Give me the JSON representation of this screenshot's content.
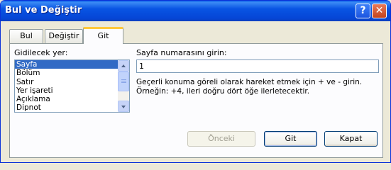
{
  "window": {
    "title": "Bul ve Değiştir"
  },
  "titlebar_buttons": {
    "help": "?",
    "close": "✕"
  },
  "tabs": [
    {
      "label": "Bul"
    },
    {
      "label": "Değiştir"
    },
    {
      "label": "Git",
      "selected": true
    }
  ],
  "goto_list": {
    "label": "Gidilecek yer:",
    "items": [
      "Sayfa",
      "Bölüm",
      "Satır",
      "Yer işareti",
      "Açıklama",
      "Dipnot"
    ],
    "selected": "Sayfa"
  },
  "page_number": {
    "label": "Sayfa numarasını girin:",
    "value": "1"
  },
  "help_text": "Geçerli konuma göreli olarak hareket etmek için + ve - girin. Örneğin: +4, ileri doğru dört öğe ilerletecektir.",
  "buttons": {
    "previous": "Önceki",
    "goto": "Git",
    "close": "Kapat"
  },
  "colors": {
    "titlebar": "#0854e3",
    "selection": "#316ac5",
    "active_tab_accent": "#ffc83c",
    "dialog_bg": "#ece9d8"
  }
}
